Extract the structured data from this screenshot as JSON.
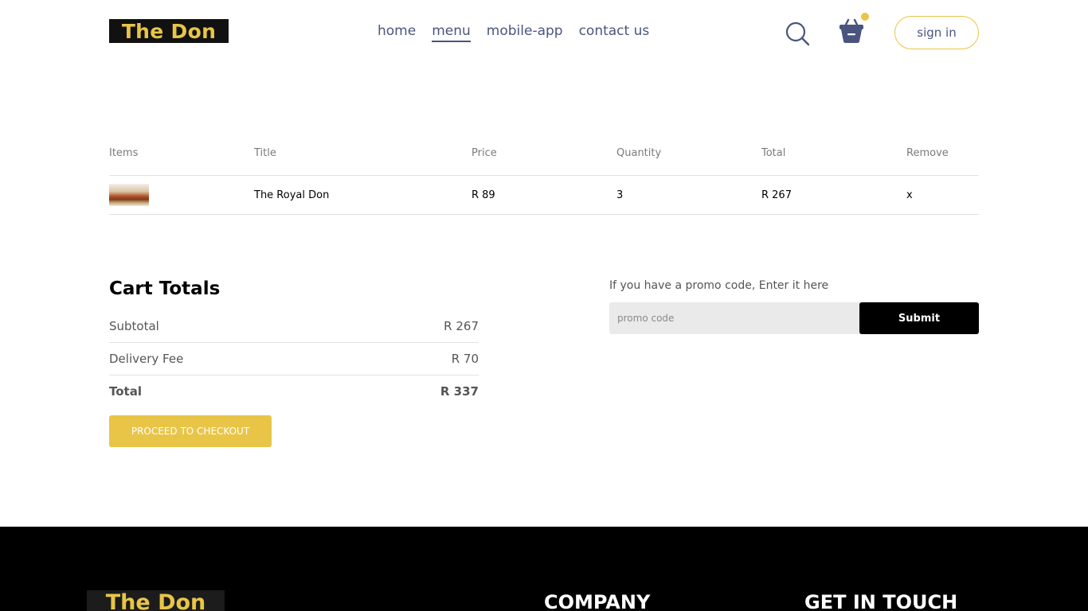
{
  "header": {
    "logo_text": "The Don",
    "nav": [
      {
        "label": "home"
      },
      {
        "label": "menu"
      },
      {
        "label": "mobile-app"
      },
      {
        "label": "contact us"
      }
    ],
    "signin_label": "sign in",
    "icons": {
      "search": "search-icon",
      "cart": "basket-icon"
    },
    "accent": "#e8c547",
    "active_nav": "menu"
  },
  "cart": {
    "headers": [
      "Items",
      "Title",
      "Price",
      "Quantity",
      "Total",
      "Remove"
    ],
    "items": [
      {
        "title": "The Royal Don",
        "price": "R 89",
        "quantity": "3",
        "total": "R 267",
        "remove": "x"
      }
    ]
  },
  "totals": {
    "title": "Cart Totals",
    "subtotal_label": "Subtotal",
    "subtotal_value": "R 267",
    "delivery_label": "Delivery Fee",
    "delivery_value": "R 70",
    "total_label": "Total",
    "total_value": "R 337",
    "checkout_label": "PROCEED TO CHECKOUT"
  },
  "promo": {
    "text": "If you have a promo code, Enter it here",
    "placeholder": "promo code",
    "submit_label": "Submit"
  },
  "footer": {
    "logo_text": "The Don",
    "company_heading": "COMPANY",
    "contact_heading": "GET IN TOUCH"
  }
}
